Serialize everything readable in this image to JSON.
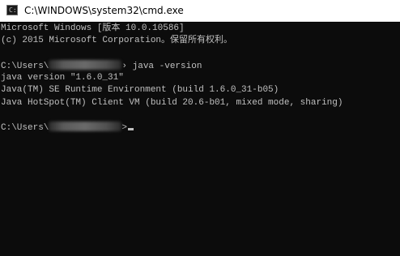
{
  "window": {
    "title": "C:\\WINDOWS\\system32\\cmd.exe",
    "icon": "cmd-icon"
  },
  "console": {
    "header_line_1": "Microsoft Windows [版本 10.0.10586]",
    "header_line_2": "(c) 2015 Microsoft Corporation。保留所有权利。",
    "prompt1_prefix": "C:\\Users\\",
    "prompt1_suffix": "› java -version",
    "output_line_1": "java version \"1.6.0_31\"",
    "output_line_2": "Java(TM) SE Runtime Environment (build 1.6.0_31-b05)",
    "output_line_3": "Java HotSpot(TM) Client VM (build 20.6-b01, mixed mode, sharing)",
    "prompt2_prefix": "C:\\Users\\",
    "prompt2_suffix": ">"
  }
}
